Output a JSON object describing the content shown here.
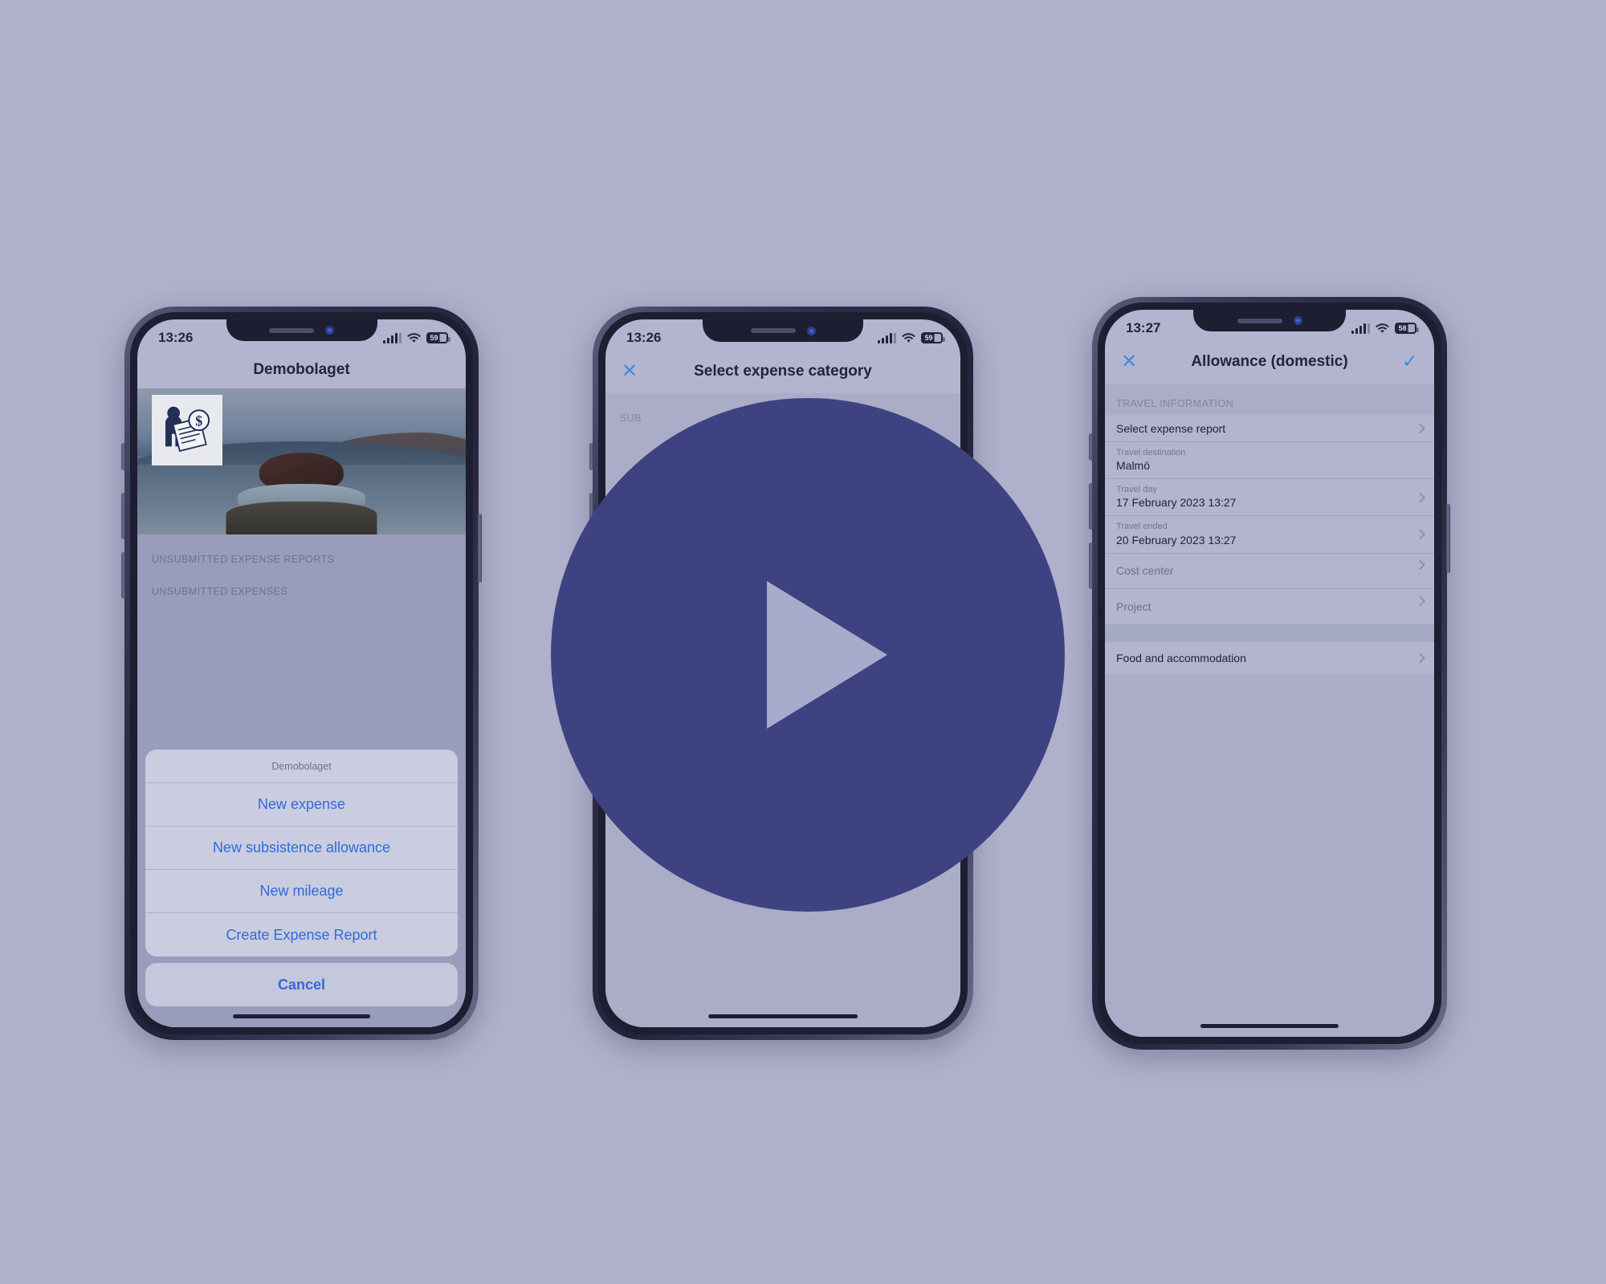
{
  "background_color": "#aeb0cc",
  "play_overlay": {
    "name": "play-button",
    "circle_color": "#3f4281",
    "triangle_color": "#a9abcd",
    "label": "Play video"
  },
  "phones": [
    {
      "id": "phone-1",
      "status": {
        "time": "13:26",
        "battery": "59",
        "wifi": "wifi-icon",
        "signal": "cellular-signal-icon"
      },
      "navbar": {
        "title": "Demobolaget"
      },
      "hero": {
        "logo_alt": "expense-report-logo"
      },
      "sections": [
        {
          "label": "UNSUBMITTED EXPENSE REPORTS"
        },
        {
          "label": "UNSUBMITTED EXPENSES"
        }
      ],
      "action_sheet": {
        "title": "Demobolaget",
        "items": [
          "New expense",
          "New subsistence allowance",
          "New mileage",
          "Create Expense Report"
        ],
        "cancel": "Cancel"
      }
    },
    {
      "id": "phone-2",
      "status": {
        "time": "13:26",
        "battery": "59",
        "wifi": "wifi-icon",
        "signal": "cellular-signal-icon"
      },
      "navbar": {
        "close": "✕",
        "title": "Select expense category"
      },
      "section_label": "SUB"
    },
    {
      "id": "phone-3",
      "status": {
        "time": "13:27",
        "battery": "58",
        "wifi": "wifi-icon",
        "signal": "cellular-signal-icon"
      },
      "navbar": {
        "close": "✕",
        "title": "Allowance (domestic)",
        "confirm": "✓"
      },
      "form": {
        "section_header": "TRAVEL INFORMATION",
        "rows": [
          {
            "kind": "single",
            "value": "Select expense report",
            "chevron": true,
            "muted": false
          },
          {
            "kind": "pair",
            "label": "Travel destination",
            "value": "Malmö",
            "chevron": false
          },
          {
            "kind": "pair",
            "label": "Travel day",
            "value": "17 February 2023 13:27",
            "chevron": true
          },
          {
            "kind": "pair",
            "label": "Travel ended",
            "value": "20 February 2023 13:27",
            "chevron": true
          },
          {
            "kind": "single",
            "value": "Cost center",
            "chevron": true,
            "muted": true
          },
          {
            "kind": "single",
            "value": "Project",
            "chevron": true,
            "muted": true
          }
        ],
        "rows2": [
          {
            "kind": "single",
            "value": "Food and accommodation",
            "chevron": true,
            "muted": false
          }
        ]
      }
    }
  ]
}
